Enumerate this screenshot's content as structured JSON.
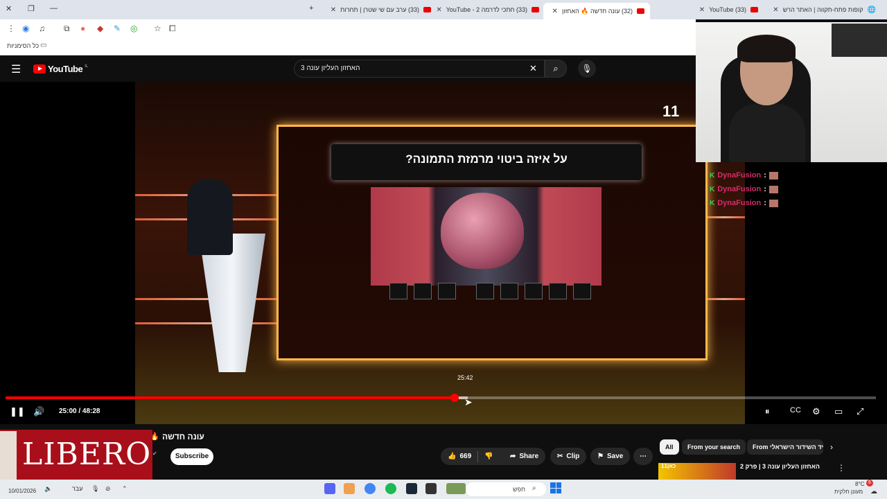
{
  "browser": {
    "tabs": [
      {
        "title": "קופות פתח-תקווה | האתר הרש"
      },
      {
        "title": "(33) YouTube"
      },
      {
        "title": "(32) עונה חדשה 🔥 האחזון"
      },
      {
        "title": "(33) חתכי לדרמה 2 - YouTube"
      },
      {
        "title": "(33) ערב עם שי שטרן | תחרות"
      }
    ],
    "bookmarks_label": "כל הסימניות"
  },
  "youtube": {
    "logo_text": "YouTube",
    "logo_region": "IL",
    "search_value": "האחזון העליון עונה 3"
  },
  "video": {
    "question_text": "על איזה ביטוי מרמזת התמונה?",
    "channel_watermark": "11",
    "hover_time": "25:42",
    "time_display": "25:00 / 48:28",
    "progress": 0.516,
    "hover_progress": 0.531
  },
  "chat": [
    {
      "user": "DynaFusion",
      "text": ":"
    },
    {
      "user": "DynaFusion",
      "text": ":"
    },
    {
      "user": "DynaFusion",
      "text": ":"
    }
  ],
  "below": {
    "title": "עונה חדשה",
    "subscribe": "Subscribe",
    "likes": "669",
    "share": "Share",
    "clip": "Clip",
    "save": "Save",
    "chips": [
      "All",
      "From your search",
      "From ניד השידור הישראלי"
    ],
    "rec_title": "האחזון העליון עונה 3 | פרק 2",
    "rec_channel": "כאן11",
    "ad_text": "LIBERO"
  },
  "taskbar": {
    "date": "10/01/2026",
    "lang": "עבר",
    "search_placeholder": "חפש",
    "weather_temp": "8°C",
    "weather_desc": "מעונן חלקית",
    "notif_count": "6"
  },
  "colors": {
    "yt_red": "#ff0000",
    "chat_name": "#d42c6a",
    "frame_glow": "#ffb84a"
  }
}
